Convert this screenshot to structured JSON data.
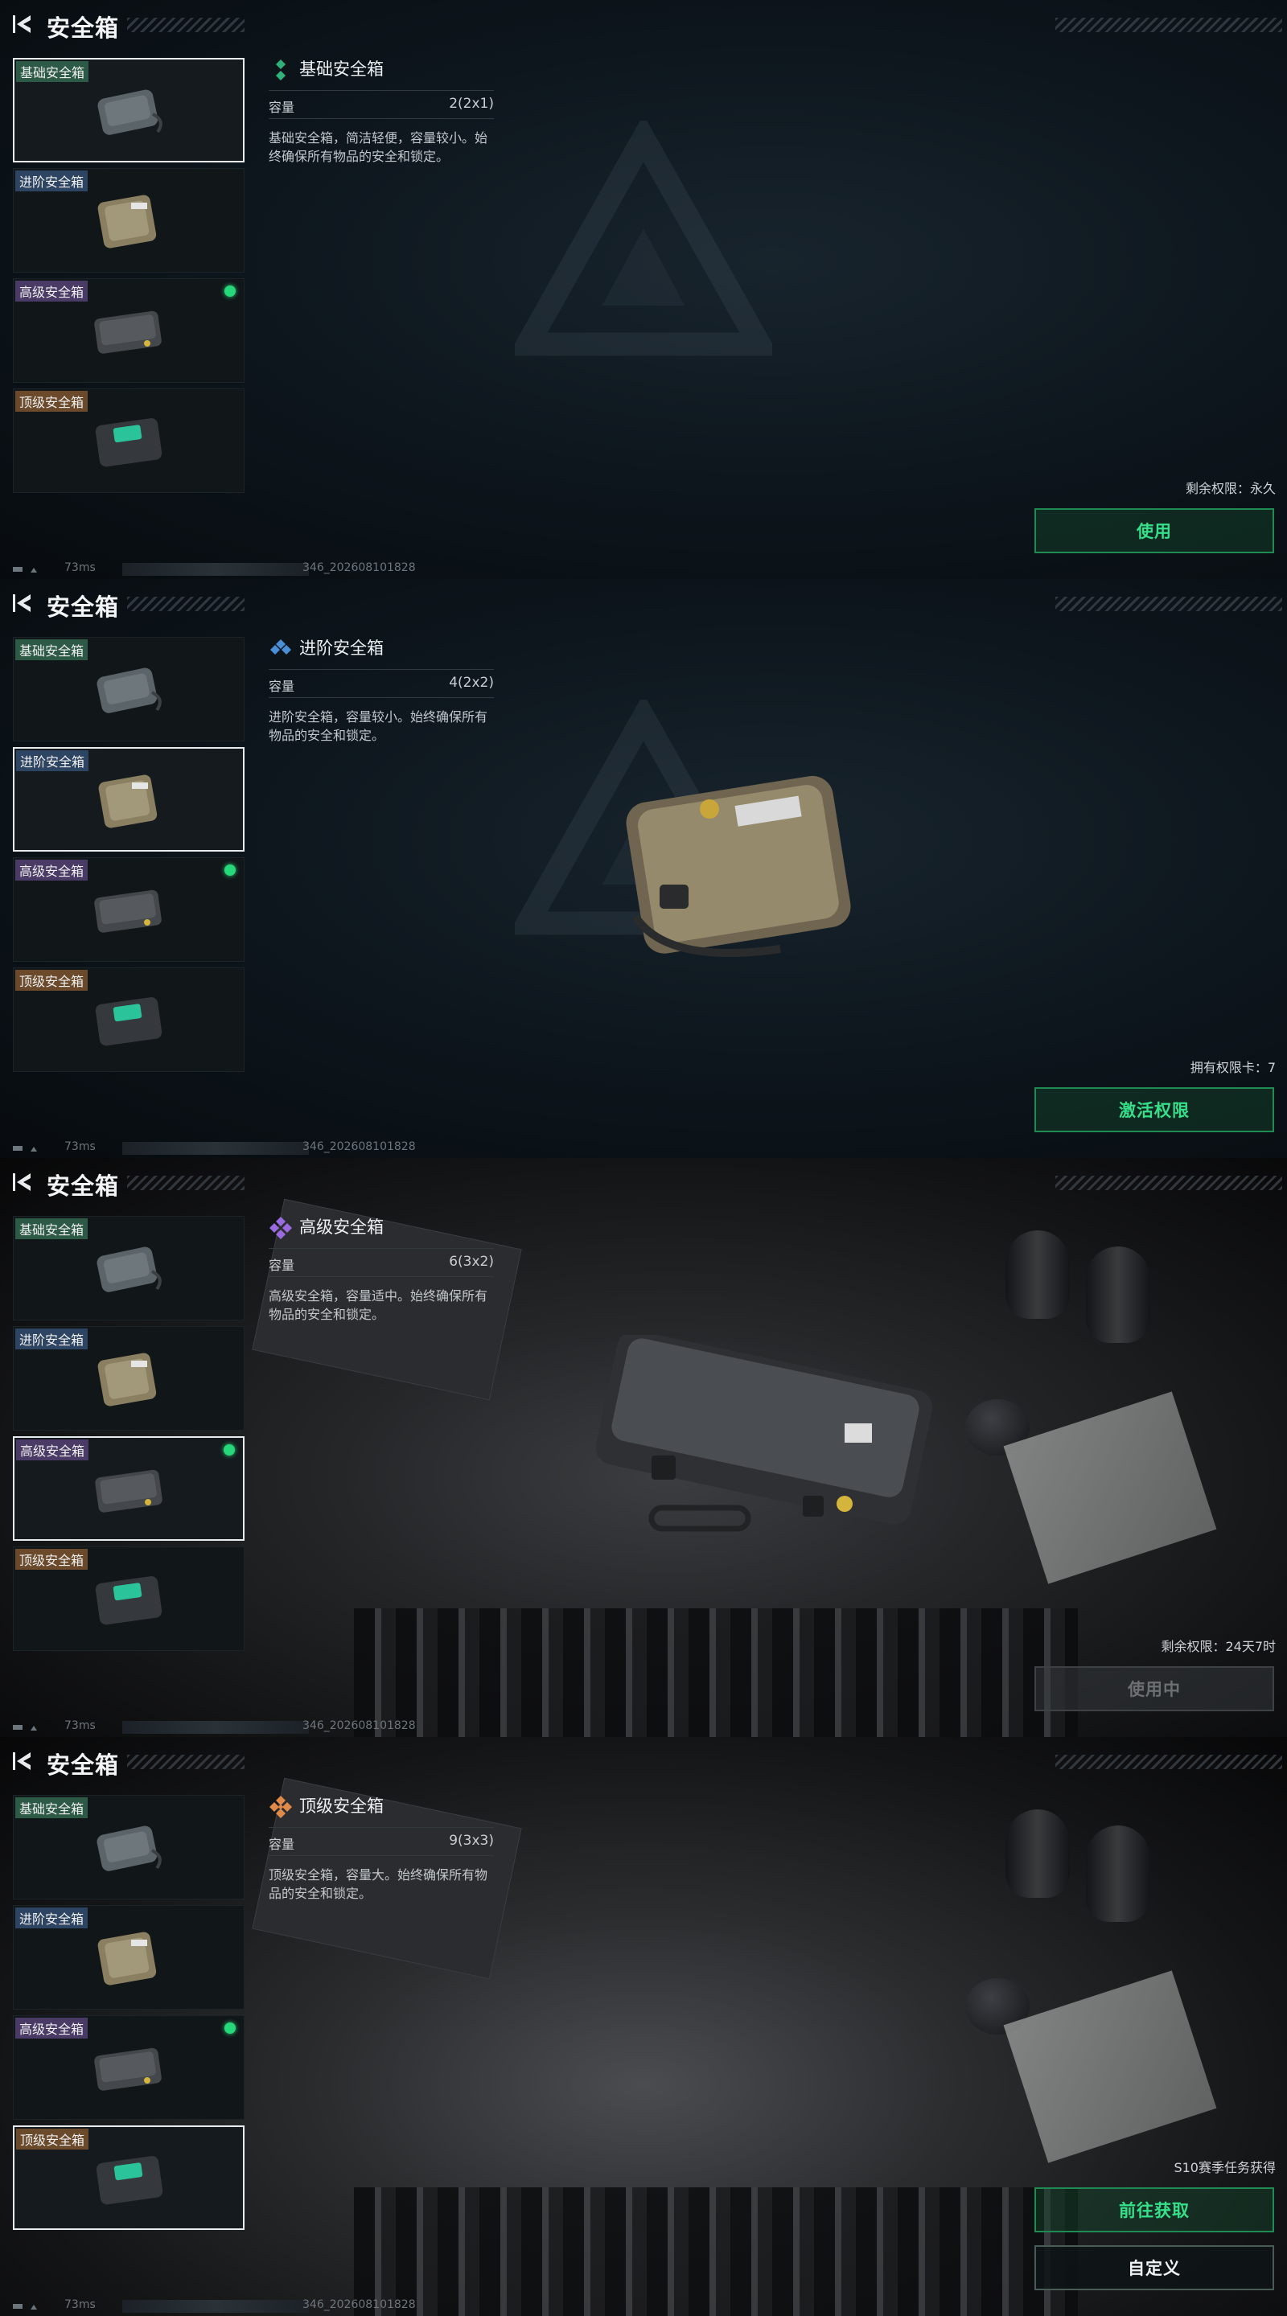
{
  "header": {
    "title": "安全箱"
  },
  "sidebar": {
    "items": [
      {
        "label": "基础安全箱"
      },
      {
        "label": "进阶安全箱"
      },
      {
        "label": "高级安全箱"
      },
      {
        "label": "顶级安全箱"
      }
    ]
  },
  "footer": {
    "ping": "73ms",
    "build": "346_202608101828"
  },
  "screens": [
    {
      "selected_index": 0,
      "detail": {
        "name": "基础安全箱",
        "capacity_label": "容量",
        "capacity_value": "2(2x1)",
        "description": "基础安全箱，简洁轻便，容量较小。始终确保所有物品的安全和锁定。"
      },
      "status_text": "剩余权限：永久",
      "buttons": [
        {
          "label": "使用"
        }
      ]
    },
    {
      "selected_index": 1,
      "detail": {
        "name": "进阶安全箱",
        "capacity_label": "容量",
        "capacity_value": "4(2x2)",
        "description": "进阶安全箱，容量较小。始终确保所有物品的安全和锁定。"
      },
      "status_text": "拥有权限卡：7",
      "buttons": [
        {
          "label": "激活权限"
        }
      ]
    },
    {
      "selected_index": 2,
      "detail": {
        "name": "高级安全箱",
        "capacity_label": "容量",
        "capacity_value": "6(3x2)",
        "description": "高级安全箱，容量适中。始终确保所有物品的安全和锁定。"
      },
      "status_text": "剩余权限：24天7时",
      "buttons": [
        {
          "label": "使用中"
        }
      ]
    },
    {
      "selected_index": 3,
      "detail": {
        "name": "顶级安全箱",
        "capacity_label": "容量",
        "capacity_value": "9(3x3)",
        "description": "顶级安全箱，容量大。始终确保所有物品的安全和锁定。"
      },
      "status_text": "S10赛季任务获得",
      "buttons": [
        {
          "label": "前往获取"
        },
        {
          "label": "自定义"
        }
      ]
    }
  ],
  "colors": {
    "accent_green": "#34e08a",
    "basic": "#2fb37a",
    "advanced": "#4a8fd6",
    "high": "#9a6be0",
    "top": "#e08a4a"
  }
}
